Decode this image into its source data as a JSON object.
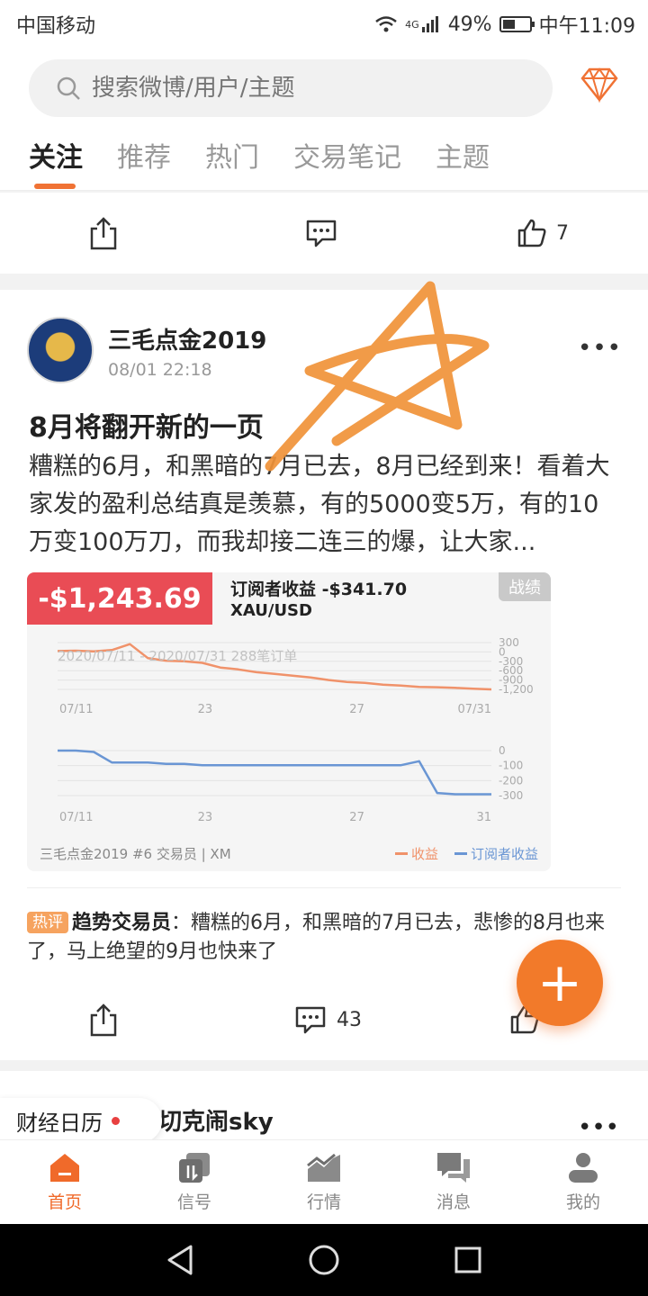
{
  "status": {
    "carrier": "中国移动",
    "network": "4G",
    "battery": "49%",
    "time": "中午11:09",
    "battery_level": 0.49
  },
  "search": {
    "placeholder": "搜索微博/用户/主题"
  },
  "tabs": [
    {
      "label": "关注",
      "active": true
    },
    {
      "label": "推荐"
    },
    {
      "label": "热门"
    },
    {
      "label": "交易笔记"
    },
    {
      "label": "主题"
    }
  ],
  "top_actions": {
    "like_count": "7"
  },
  "post": {
    "author": "三毛点金2019",
    "datetime": "08/01 22:18",
    "title": "8月将翻开新的一页",
    "body": "糟糕的6月，和黑暗的7月已去，8月已经到来！看着大家发的盈利总结真是羡慕，有的5000变5万，有的10万变100万刀，而我却接二连三的爆，让大家...",
    "trade": {
      "pnl": "-$1,243.69",
      "subscriber_profit": "订阅者收益 -$341.70",
      "symbol": "XAU/USD",
      "badge": "战绩",
      "period": "2020/07/11 - 2020/07/31  288笔订单",
      "footer": "三毛点金2019 #6    交易员 | XM",
      "legend_profit": "收益",
      "legend_sub": "订阅者收益",
      "color_profit": "#f0926a",
      "color_sub": "#6a96d4"
    },
    "comment": {
      "tag": "热评",
      "user": "趋势交易员",
      "text": "：糟糕的6月，和黑暗的7月已去，悲惨的8月也来了，马上绝望的9月也快来了"
    },
    "comment_count": "43"
  },
  "chart_data": [
    {
      "type": "line",
      "title": "",
      "xlabel": "",
      "ylabel": "",
      "x_ticks": [
        "07/11",
        "23",
        "27",
        "07/31"
      ],
      "y_ticks": [
        "300",
        "0",
        "-300",
        "-600",
        "-900",
        "-1,200"
      ],
      "ylim": [
        -1200,
        300
      ],
      "series": [
        {
          "name": "收益",
          "values": [
            30,
            40,
            20,
            60,
            250,
            -200,
            -280,
            -300,
            -350,
            -500,
            -560,
            -650,
            -700,
            -760,
            -820,
            -900,
            -960,
            -990,
            -1050,
            -1080,
            -1120,
            -1130,
            -1150,
            -1180,
            -1200
          ]
        }
      ]
    },
    {
      "type": "line",
      "title": "",
      "x_ticks": [
        "07/11",
        "23",
        "27",
        "31"
      ],
      "y_ticks": [
        "0",
        "-100",
        "-200",
        "-300"
      ],
      "ylim": [
        -340,
        0
      ],
      "series": [
        {
          "name": "订阅者收益",
          "values": [
            0,
            0,
            -10,
            -90,
            -90,
            -90,
            -100,
            -100,
            -110,
            -110,
            -110,
            -110,
            -110,
            -110,
            -110,
            -110,
            -110,
            -110,
            -110,
            -110,
            -80,
            -320,
            -330,
            -330,
            -330
          ]
        }
      ]
    }
  ],
  "second_post": {
    "author_partial": "切克闹sky"
  },
  "calendar": {
    "label": "财经日历"
  },
  "bottom_tabs": [
    {
      "label": "首页",
      "active": true
    },
    {
      "label": "信号"
    },
    {
      "label": "行情"
    },
    {
      "label": "消息"
    },
    {
      "label": "我的"
    }
  ]
}
